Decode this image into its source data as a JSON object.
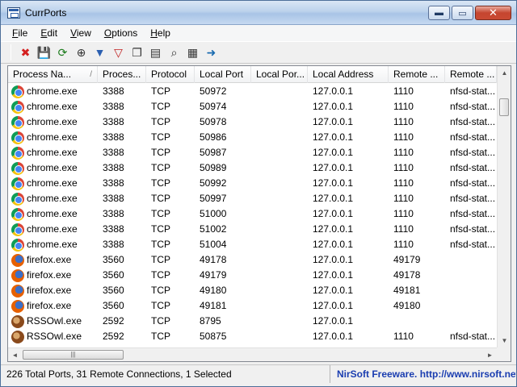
{
  "window": {
    "title": "CurrPorts",
    "controls": {
      "minimize": "▬",
      "maximize": "▭",
      "close": "✕"
    }
  },
  "menu": [
    {
      "first": "F",
      "rest": "ile"
    },
    {
      "first": "E",
      "rest": "dit"
    },
    {
      "first": "V",
      "rest": "iew"
    },
    {
      "first": "O",
      "rest": "ptions"
    },
    {
      "first": "H",
      "rest": "elp"
    }
  ],
  "toolbar": [
    {
      "icon": "close-connection-icon",
      "glyph": "✖",
      "color": "#d42020"
    },
    {
      "icon": "save-icon",
      "glyph": "💾",
      "color": "#2b2b2b"
    },
    {
      "icon": "refresh-icon",
      "glyph": "⟳",
      "color": "#1a7a1a"
    },
    {
      "icon": "target-icon",
      "glyph": "⊕",
      "color": "#333333"
    },
    {
      "icon": "filter-icon",
      "glyph": "▼",
      "color": "#2b5fb0"
    },
    {
      "icon": "filter-clear-icon",
      "glyph": "▽",
      "color": "#c02020"
    },
    {
      "icon": "copy-icon",
      "glyph": "❐",
      "color": "#333333"
    },
    {
      "icon": "properties-icon",
      "glyph": "▤",
      "color": "#333333"
    },
    {
      "icon": "find-icon",
      "glyph": "⌕",
      "color": "#333333"
    },
    {
      "icon": "report-icon",
      "glyph": "▦",
      "color": "#333333"
    },
    {
      "icon": "exit-icon",
      "glyph": "➜",
      "color": "#1a6bb0"
    }
  ],
  "columns": [
    {
      "label": "Process Na...",
      "sorted": true,
      "sort_glyph": "/"
    },
    {
      "label": "Proces..."
    },
    {
      "label": "Protocol"
    },
    {
      "label": "Local Port"
    },
    {
      "label": "Local Por..."
    },
    {
      "label": "Local Address"
    },
    {
      "label": "Remote ..."
    },
    {
      "label": "Remote ..."
    }
  ],
  "rows": [
    {
      "icon": "chrome",
      "process": "chrome.exe",
      "pid": "3388",
      "protocol": "TCP",
      "local_port": "50972",
      "local_port_name": "",
      "local_address": "127.0.0.1",
      "remote_port": "1110",
      "remote_port_name": "nfsd-stat..."
    },
    {
      "icon": "chrome",
      "process": "chrome.exe",
      "pid": "3388",
      "protocol": "TCP",
      "local_port": "50974",
      "local_port_name": "",
      "local_address": "127.0.0.1",
      "remote_port": "1110",
      "remote_port_name": "nfsd-stat..."
    },
    {
      "icon": "chrome",
      "process": "chrome.exe",
      "pid": "3388",
      "protocol": "TCP",
      "local_port": "50978",
      "local_port_name": "",
      "local_address": "127.0.0.1",
      "remote_port": "1110",
      "remote_port_name": "nfsd-stat..."
    },
    {
      "icon": "chrome",
      "process": "chrome.exe",
      "pid": "3388",
      "protocol": "TCP",
      "local_port": "50986",
      "local_port_name": "",
      "local_address": "127.0.0.1",
      "remote_port": "1110",
      "remote_port_name": "nfsd-stat..."
    },
    {
      "icon": "chrome",
      "process": "chrome.exe",
      "pid": "3388",
      "protocol": "TCP",
      "local_port": "50987",
      "local_port_name": "",
      "local_address": "127.0.0.1",
      "remote_port": "1110",
      "remote_port_name": "nfsd-stat..."
    },
    {
      "icon": "chrome",
      "process": "chrome.exe",
      "pid": "3388",
      "protocol": "TCP",
      "local_port": "50989",
      "local_port_name": "",
      "local_address": "127.0.0.1",
      "remote_port": "1110",
      "remote_port_name": "nfsd-stat..."
    },
    {
      "icon": "chrome",
      "process": "chrome.exe",
      "pid": "3388",
      "protocol": "TCP",
      "local_port": "50992",
      "local_port_name": "",
      "local_address": "127.0.0.1",
      "remote_port": "1110",
      "remote_port_name": "nfsd-stat..."
    },
    {
      "icon": "chrome",
      "process": "chrome.exe",
      "pid": "3388",
      "protocol": "TCP",
      "local_port": "50997",
      "local_port_name": "",
      "local_address": "127.0.0.1",
      "remote_port": "1110",
      "remote_port_name": "nfsd-stat..."
    },
    {
      "icon": "chrome",
      "process": "chrome.exe",
      "pid": "3388",
      "protocol": "TCP",
      "local_port": "51000",
      "local_port_name": "",
      "local_address": "127.0.0.1",
      "remote_port": "1110",
      "remote_port_name": "nfsd-stat..."
    },
    {
      "icon": "chrome",
      "process": "chrome.exe",
      "pid": "3388",
      "protocol": "TCP",
      "local_port": "51002",
      "local_port_name": "",
      "local_address": "127.0.0.1",
      "remote_port": "1110",
      "remote_port_name": "nfsd-stat..."
    },
    {
      "icon": "chrome",
      "process": "chrome.exe",
      "pid": "3388",
      "protocol": "TCP",
      "local_port": "51004",
      "local_port_name": "",
      "local_address": "127.0.0.1",
      "remote_port": "1110",
      "remote_port_name": "nfsd-stat..."
    },
    {
      "icon": "firefox",
      "process": "firefox.exe",
      "pid": "3560",
      "protocol": "TCP",
      "local_port": "49178",
      "local_port_name": "",
      "local_address": "127.0.0.1",
      "remote_port": "49179",
      "remote_port_name": ""
    },
    {
      "icon": "firefox",
      "process": "firefox.exe",
      "pid": "3560",
      "protocol": "TCP",
      "local_port": "49179",
      "local_port_name": "",
      "local_address": "127.0.0.1",
      "remote_port": "49178",
      "remote_port_name": ""
    },
    {
      "icon": "firefox",
      "process": "firefox.exe",
      "pid": "3560",
      "protocol": "TCP",
      "local_port": "49180",
      "local_port_name": "",
      "local_address": "127.0.0.1",
      "remote_port": "49181",
      "remote_port_name": ""
    },
    {
      "icon": "firefox",
      "process": "firefox.exe",
      "pid": "3560",
      "protocol": "TCP",
      "local_port": "49181",
      "local_port_name": "",
      "local_address": "127.0.0.1",
      "remote_port": "49180",
      "remote_port_name": ""
    },
    {
      "icon": "rssowl",
      "process": "RSSOwl.exe",
      "pid": "2592",
      "protocol": "TCP",
      "local_port": "8795",
      "local_port_name": "",
      "local_address": "127.0.0.1",
      "remote_port": "",
      "remote_port_name": ""
    },
    {
      "icon": "rssowl",
      "process": "RSSOwl.exe",
      "pid": "2592",
      "protocol": "TCP",
      "local_port": "50875",
      "local_port_name": "",
      "local_address": "127.0.0.1",
      "remote_port": "1110",
      "remote_port_name": "nfsd-stat..."
    }
  ],
  "scrollbars": {
    "up": "▲",
    "down": "▼",
    "left": "◄",
    "right": "►",
    "grip": "|||"
  },
  "status": {
    "summary": "226 Total Ports, 31 Remote Connections, 1 Selected",
    "credit": "NirSoft Freeware.  http://www.nirsoft.net"
  }
}
